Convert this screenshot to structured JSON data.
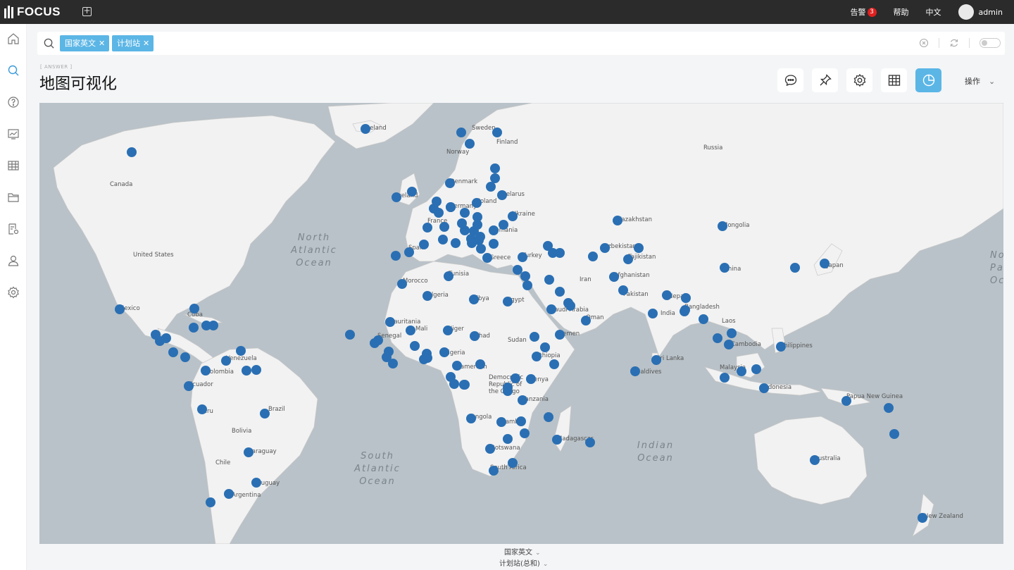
{
  "app": {
    "brand": "FOCUS"
  },
  "topbar": {
    "alert_label": "告警",
    "alert_count": "3",
    "help_label": "帮助",
    "lang_label": "中文",
    "user_name": "admin"
  },
  "search": {
    "chips": [
      {
        "label": "国家英文"
      },
      {
        "label": "计划站"
      }
    ]
  },
  "answer_tag": "[ ANSWER ]",
  "page_title": "地图可视化",
  "toolbar": {
    "ops_label": "操作"
  },
  "axis": {
    "x_label": "国家英文",
    "y_label": "计划站(总和)"
  },
  "map": {
    "ocean_labels": [
      {
        "lines": [
          "North",
          "Atlantic",
          "Ocean"
        ]
      },
      {
        "lines": [
          "South",
          "Atlantic",
          "Ocean"
        ]
      },
      {
        "lines": [
          "Indian",
          "Ocean"
        ]
      },
      {
        "lines": [
          "Nor",
          "Pac",
          "Oce"
        ]
      }
    ],
    "country_labels": [
      "Canada",
      "United States",
      "Mexico",
      "Cuba",
      "Venezuela",
      "Colombia",
      "Ecuador",
      "Peru",
      "Brazil",
      "Bolivia",
      "Paraguay",
      "Chile",
      "Argentina",
      "Uruguay",
      "Iceland",
      "Sweden",
      "Finland",
      "Norway",
      "Russia",
      "Denmark",
      "Ireland",
      "Belarus",
      "Poland",
      "Germany",
      "Ukraine",
      "France",
      "Romania",
      "Spain",
      "Greece",
      "Turkey",
      "Morocco",
      "Tunisia",
      "Algeria",
      "Libya",
      "Egypt",
      "Mauritania",
      "Mali",
      "Niger",
      "Chad",
      "Sudan",
      "Senegal",
      "Nigeria",
      "Ethiopia",
      "Cameroon",
      "Democratic Republic of the Congo",
      "Kenya",
      "Tanzania",
      "Angola",
      "Zambia",
      "Botswana",
      "Madagascar",
      "South Africa",
      "Saudi Arabia",
      "Yemen",
      "Oman",
      "Iran",
      "Kazakhstan",
      "Uzbekistan",
      "Tajikistan",
      "Afghanistan",
      "Pakistan",
      "India",
      "Nepal",
      "Bangladesh",
      "Mongolia",
      "China",
      "Japan",
      "Laos",
      "Cambodia",
      "Philippines",
      "Sri Lanka",
      "Maldives",
      "Malaysia",
      "Indonesia",
      "Papua New Guinea",
      "Australia",
      "New Zealand"
    ]
  },
  "colors": {
    "accent": "#5bb6e6",
    "point": "#2a6fb3",
    "land": "#f2f2f2",
    "water": "#b9c2c8",
    "alert": "#e02020"
  }
}
